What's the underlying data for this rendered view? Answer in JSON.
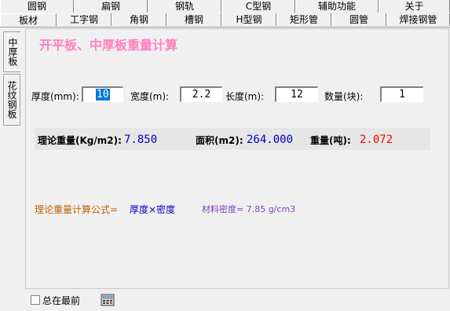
{
  "tabs_row1": [
    "圆钢",
    "扁钢",
    "钢轨",
    "C型钢",
    "辅助功能",
    "关于"
  ],
  "tabs_row2": [
    "板材",
    "工字钢",
    "角钢",
    "槽钢",
    "H型钢",
    "矩形管",
    "圆管",
    "焊接钢管"
  ],
  "vertical_tabs": [
    "中厚板",
    "花纹钢板"
  ],
  "panel": {
    "title": "开平板、中厚板重量计算"
  },
  "inputs": {
    "thickness_label": "厚度(mm):",
    "thickness_value": "10",
    "width_label": "宽度(m):",
    "width_value": "2.2",
    "length_label": "长度(m):",
    "length_value": "12",
    "quantity_label": "数量(块):",
    "quantity_value": "1"
  },
  "results": {
    "theoretical_label": "理论重量(Kg/m2):",
    "theoretical_value": "7.850",
    "area_label": "面积(m2):",
    "area_value": "264.000",
    "weight_label": "重量(吨):",
    "weight_value": "2.072"
  },
  "formula": {
    "label": "理论重量计算公式=",
    "expression": "厚度×密度",
    "density": "材料密度= 7.85 g/cm3"
  },
  "footer": {
    "always_on_top_label": "总在最前"
  },
  "colors": {
    "title": "#ff80c0",
    "result_blue": "#0000c0",
    "result_red": "#ff0000",
    "formula_label": "#c06000",
    "formula_expr": "#0000c0",
    "density_text": "#8040c0"
  }
}
